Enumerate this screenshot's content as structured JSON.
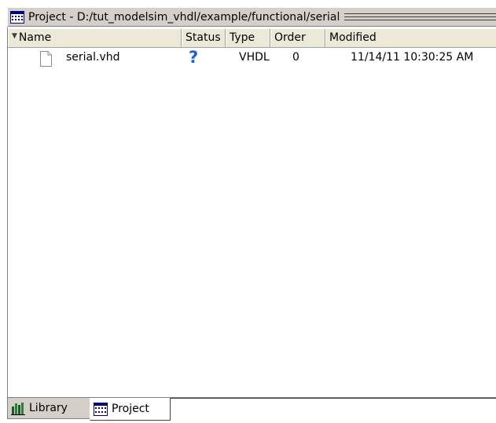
{
  "window": {
    "title": "Project - D:/tut_modelsim_vhdl/example/functional/serial"
  },
  "columns": {
    "name": "Name",
    "status": "Status",
    "type": "Type",
    "order": "Order",
    "modified": "Modified"
  },
  "rows": [
    {
      "name": "serial.vhd",
      "status": "?",
      "type": "VHDL",
      "order": "0",
      "modified": "11/14/11 10:30:25 AM"
    }
  ],
  "tabs": [
    {
      "label": "Library",
      "icon": "library-icon",
      "active": false
    },
    {
      "label": "Project",
      "icon": "project-icon",
      "active": true
    }
  ],
  "colors": {
    "status_question": "#1a5fd6",
    "chrome": "#d4d0c8",
    "header": "#ece9d8"
  }
}
